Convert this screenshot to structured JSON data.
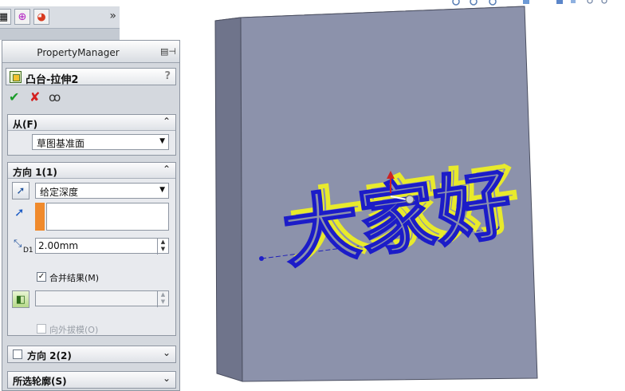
{
  "top_tabs": {
    "icons": [
      "tree-icon",
      "target-icon",
      "appearance-icon"
    ],
    "more_label": "»"
  },
  "property_manager": {
    "title": "PropertyManager",
    "feature_title": "凸台-拉伸2",
    "help_label": "?",
    "actions": {
      "ok_label": "✔",
      "cancel_label": "✘",
      "preview_label": "ꝏ"
    }
  },
  "from_group": {
    "title": "从(F)",
    "selected": "草图基准面"
  },
  "direction1_group": {
    "title": "方向 1(1)",
    "end_condition": "给定深度",
    "depth_value": "2.00mm",
    "depth_label": "D1",
    "merge_result_label": "合并结果(M)",
    "merge_checked": true,
    "draft_outward_label": "向外拔模(O)",
    "draft_checked": false
  },
  "direction2_group": {
    "title": "方向 2(2)",
    "checked": false
  },
  "selected_contours_group": {
    "title": "所选轮廓(S)"
  },
  "viewport": {
    "extrude_text": "大家好",
    "block_front_color": "#8c92ab",
    "block_side_color": "#6f748b",
    "block_top_color": "#a8adbf",
    "sketch_color": "#1c1cc8",
    "preview_color": "#e8ea2c"
  }
}
